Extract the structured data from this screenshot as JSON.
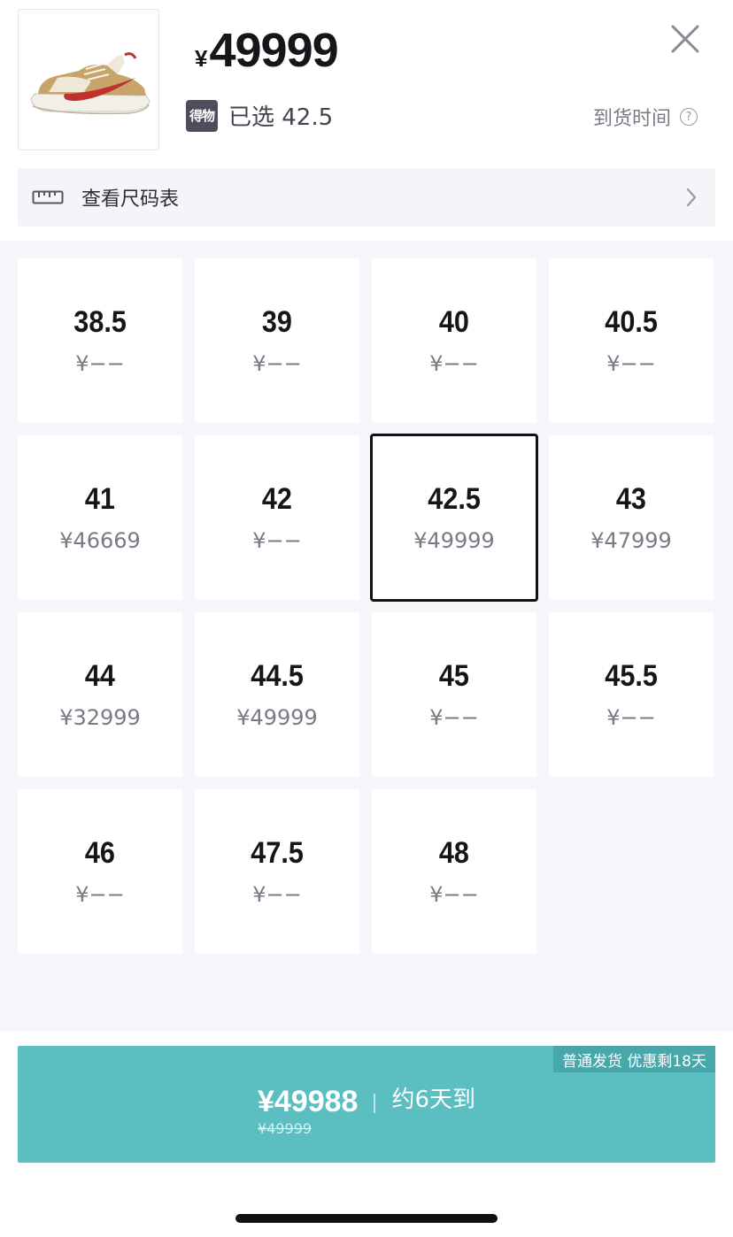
{
  "product": {
    "currency": "¥",
    "price": "49999",
    "brand_badge": "得物",
    "selected_label": "已选 42.5",
    "arrival_label": "到货时间",
    "help_glyph": "?"
  },
  "size_chart": {
    "label": "查看尺码表"
  },
  "sizes": [
    {
      "size": "38.5",
      "price": "¥−−"
    },
    {
      "size": "39",
      "price": "¥−−"
    },
    {
      "size": "40",
      "price": "¥−−"
    },
    {
      "size": "40.5",
      "price": "¥−−"
    },
    {
      "size": "41",
      "price": "¥46669"
    },
    {
      "size": "42",
      "price": "¥−−"
    },
    {
      "size": "42.5",
      "price": "¥49999",
      "selected": true
    },
    {
      "size": "43",
      "price": "¥47999"
    },
    {
      "size": "44",
      "price": "¥32999"
    },
    {
      "size": "44.5",
      "price": "¥49999"
    },
    {
      "size": "45",
      "price": "¥−−"
    },
    {
      "size": "45.5",
      "price": "¥−−"
    },
    {
      "size": "46",
      "price": "¥−−"
    },
    {
      "size": "47.5",
      "price": "¥−−"
    },
    {
      "size": "48",
      "price": "¥−−"
    }
  ],
  "buy": {
    "promo_tag": "普通发货 优惠剩18天",
    "price": "¥49988",
    "original_price": "¥49999",
    "eta": "约6天到"
  },
  "colors": {
    "accent": "#5bbfc2",
    "promo": "#47a7ab",
    "grid_bg": "#f6f6fa"
  }
}
